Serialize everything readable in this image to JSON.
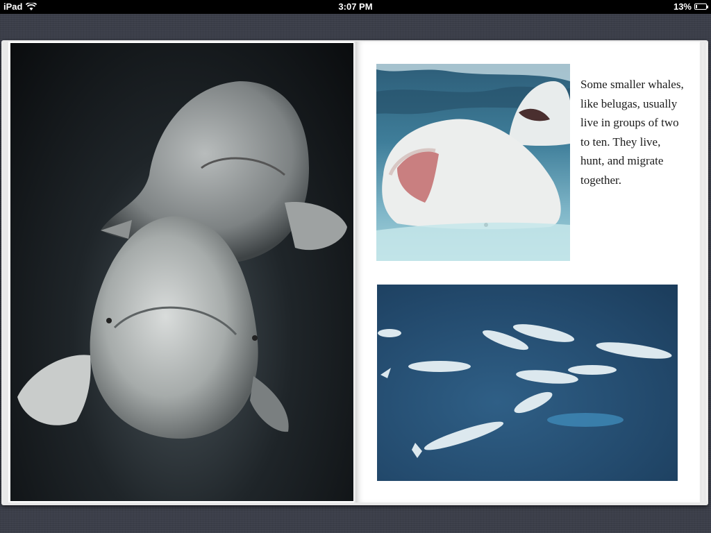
{
  "status_bar": {
    "device": "iPad",
    "time": "3:07 PM",
    "battery_percent": "13%",
    "battery_level": 0.13,
    "icons": [
      "wifi-icon",
      "battery-icon"
    ]
  },
  "book": {
    "page_text": "Some smaller whales, like belugas, usually live in groups of two to ten. They live, hunt, and migrate together."
  },
  "colors": {
    "status_bar_background": "#000000",
    "desk_background": "#3b3e49",
    "page_background": "#ffffff"
  }
}
